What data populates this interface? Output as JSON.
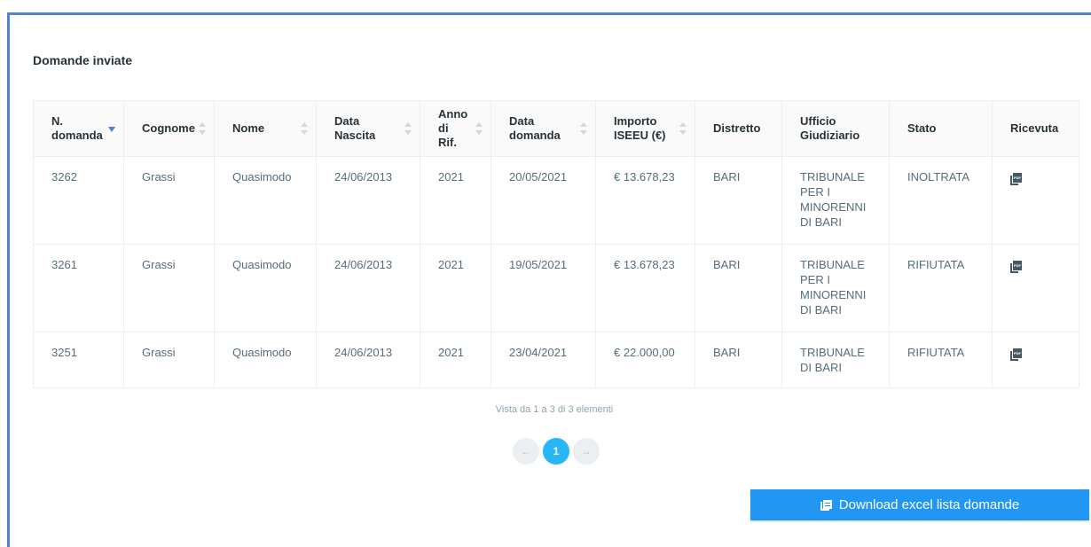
{
  "section": {
    "title": "Domande inviate"
  },
  "table": {
    "headers": {
      "n_domanda": "N. domanda",
      "cognome": "Cognome",
      "nome": "Nome",
      "data_nascita": "Data Nascita",
      "anno_rif": "Anno di Rif.",
      "data_domanda": "Data domanda",
      "importo": "Importo ISEEU (€)",
      "distretto": "Distretto",
      "ufficio": "Ufficio Giudiziario",
      "stato": "Stato",
      "ricevuta": "Ricevuta"
    },
    "rows": [
      {
        "n_domanda": "3262",
        "cognome": "Grassi",
        "nome": "Quasimodo",
        "data_nascita": "24/06/2013",
        "anno_rif": "2021",
        "data_domanda": "20/05/2021",
        "importo": "€ 13.678,23",
        "distretto": "BARI",
        "ufficio": "TRIBUNALE PER I MINORENNI DI BARI",
        "stato": "INOLTRATA",
        "ricevuta_icon": "pdf-icon"
      },
      {
        "n_domanda": "3261",
        "cognome": "Grassi",
        "nome": "Quasimodo",
        "data_nascita": "24/06/2013",
        "anno_rif": "2021",
        "data_domanda": "19/05/2021",
        "importo": "€ 13.678,23",
        "distretto": "BARI",
        "ufficio": "TRIBUNALE PER I MINORENNI DI BARI",
        "stato": "RIFIUTATA",
        "ricevuta_icon": "pdf-icon"
      },
      {
        "n_domanda": "3251",
        "cognome": "Grassi",
        "nome": "Quasimodo",
        "data_nascita": "24/06/2013",
        "anno_rif": "2021",
        "data_domanda": "23/04/2021",
        "importo": "€ 22.000,00",
        "distretto": "BARI",
        "ufficio": "TRIBUNALE DI BARI",
        "stato": "RIFIUTATA",
        "ricevuta_icon": "pdf-icon"
      }
    ]
  },
  "info": {
    "text": "Vista da 1 a 3 di 3 elementi"
  },
  "pagination": {
    "prev": "←",
    "current": "1",
    "next": "→"
  },
  "actions": {
    "download_label": "Download excel lista domande",
    "download_icon": "copy-icon"
  },
  "colors": {
    "frame": "#4f86c6",
    "accent": "#2196f3",
    "page_active": "#29b6f6"
  }
}
